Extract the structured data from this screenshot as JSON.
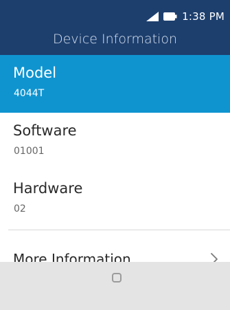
{
  "status_bar": {
    "time": "1:38 PM",
    "icons": [
      "signal-icon",
      "battery-icon"
    ]
  },
  "header": {
    "title": "Device Information"
  },
  "items": [
    {
      "label": "Model",
      "value": "4044T",
      "selected": true
    },
    {
      "label": "Software",
      "value": "01001",
      "selected": false
    },
    {
      "label": "Hardware",
      "value": "02",
      "selected": false
    }
  ],
  "more": {
    "label": "More Information",
    "icon": "chevron-right-icon"
  },
  "softkeys": {
    "center_icon": "home-icon"
  },
  "colors": {
    "header_bg": "#1d3f6e",
    "selected_bg": "#0f94d0",
    "softkey_bg": "#e4e4e4"
  }
}
